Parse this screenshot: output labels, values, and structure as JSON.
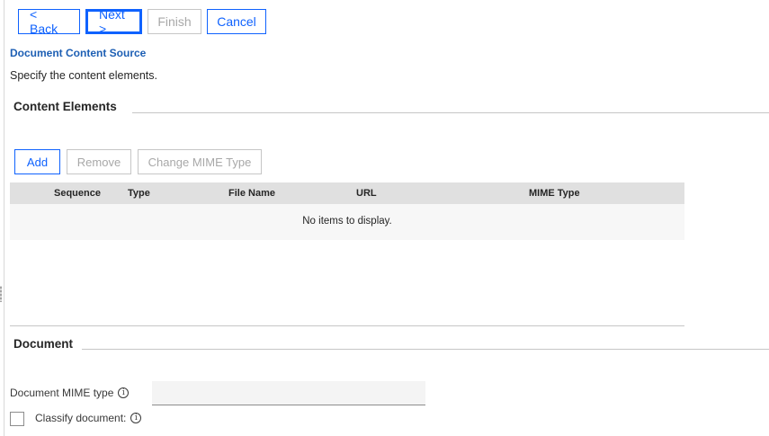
{
  "wizard": {
    "back_label": "< Back",
    "next_label": "Next >",
    "finish_label": "Finish",
    "cancel_label": "Cancel"
  },
  "page": {
    "title": "Document Content Source",
    "description": "Specify the content elements."
  },
  "content_elements": {
    "heading": "Content Elements",
    "toolbar": {
      "add_label": "Add",
      "remove_label": "Remove",
      "change_mime_label": "Change MIME Type"
    },
    "grid": {
      "columns": [
        "Sequence",
        "Type",
        "File Name",
        "URL",
        "MIME Type"
      ],
      "empty_message": "No items to display."
    }
  },
  "document": {
    "heading": "Document",
    "mime_label": "Document MIME type",
    "mime_value": "",
    "classify_label": "Classify document:",
    "classify_checked": false
  },
  "icons": {
    "info": "info-icon"
  },
  "colors": {
    "accent": "#0f62fe",
    "title_link": "#1d5fb4",
    "disabled": "#a8a8a8",
    "grid_header_bg": "#e0e0e0"
  }
}
